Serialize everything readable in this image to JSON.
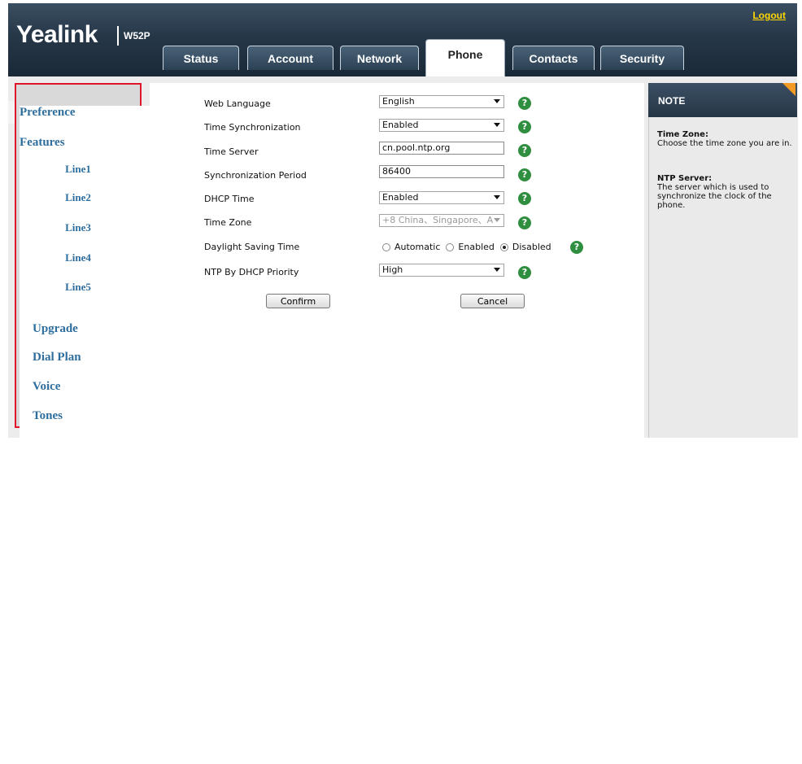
{
  "header": {
    "logo": "Yealink",
    "model": "W52P",
    "logout": "Logout"
  },
  "tabs": [
    {
      "label": "Status"
    },
    {
      "label": "Account"
    },
    {
      "label": "Network"
    },
    {
      "label": "Phone",
      "active": true
    },
    {
      "label": "Contacts"
    },
    {
      "label": "Security"
    }
  ],
  "sidebar": {
    "items": [
      {
        "label": "Preference",
        "selected": true
      },
      {
        "label": "Features"
      },
      {
        "label": "Line1"
      },
      {
        "label": "Line2"
      },
      {
        "label": "Line3"
      },
      {
        "label": "Line4"
      },
      {
        "label": "Line5"
      },
      {
        "label": "Upgrade"
      },
      {
        "label": "Dial Plan"
      },
      {
        "label": "Voice"
      },
      {
        "label": "Tones"
      }
    ]
  },
  "form": {
    "web_language": {
      "label": "Web Language",
      "value": "English"
    },
    "time_sync": {
      "label": "Time Synchronization",
      "value": "Enabled"
    },
    "time_server": {
      "label": "Time Server",
      "value": "cn.pool.ntp.org"
    },
    "sync_period": {
      "label": "Synchronization Period",
      "value": "86400"
    },
    "dhcp_time": {
      "label": "DHCP Time",
      "value": "Enabled"
    },
    "time_zone": {
      "label": "Time Zone",
      "value": "+8 China、Singapore、A"
    },
    "dst": {
      "label": "Daylight Saving Time",
      "options": [
        "Automatic",
        "Enabled",
        "Disabled"
      ],
      "selected": "Disabled"
    },
    "ntp_dhcp_priority": {
      "label": "NTP By DHCP Priority",
      "value": "High"
    },
    "help_glyph": "?",
    "confirm": "Confirm",
    "cancel": "Cancel"
  },
  "note": {
    "title": "NOTE",
    "time_zone_heading": "Time Zone:",
    "time_zone_text": "Choose the time zone you are in.",
    "ntp_heading": "NTP Server:",
    "ntp_text": "The server which is used to synchronize the clock of the phone."
  },
  "colors": {
    "header": "#263748",
    "tab_bg": "#2c4154",
    "sidebar_link": "#2e6e9e",
    "highlight_border": "#e0142a",
    "help_icon": "#2f8e3f",
    "note_corner": "#f39a24",
    "logout": "#ffd700"
  }
}
